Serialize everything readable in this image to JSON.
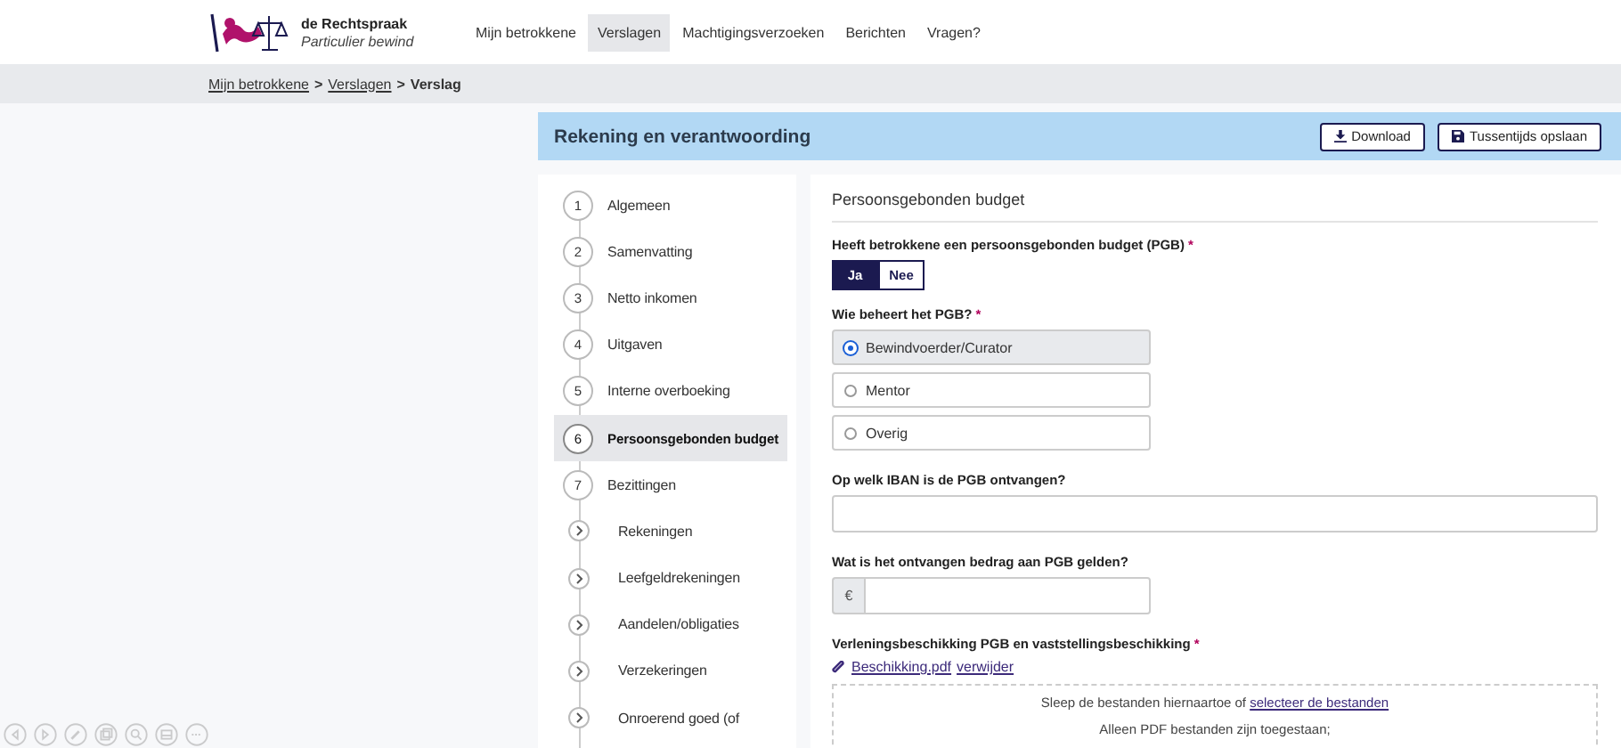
{
  "header": {
    "brand": {
      "title": "de Rechtspraak",
      "subtitle": "Particulier bewind"
    },
    "nav": [
      {
        "label": "Mijn betrokkene",
        "selected": false
      },
      {
        "label": "Verslagen",
        "selected": true
      },
      {
        "label": "Machtigingsverzoeken",
        "selected": false
      },
      {
        "label": "Berichten",
        "selected": false
      },
      {
        "label": "Vragen?",
        "selected": false
      }
    ]
  },
  "breadcrumb": {
    "separator": ">",
    "items": [
      {
        "label": "Mijn betrokkene",
        "kind": "link"
      },
      {
        "label": "Verslagen",
        "kind": "link"
      },
      {
        "label": "Verslag",
        "kind": "current"
      }
    ]
  },
  "title_bar": {
    "title": "Rekening en verantwoording",
    "buttons": [
      {
        "label": "Download",
        "kind": "download"
      },
      {
        "label": "Tussentijds opslaan",
        "kind": "save"
      }
    ]
  },
  "steps": [
    {
      "kind": "step",
      "number": "1",
      "label": "Algemeen",
      "selected": false
    },
    {
      "kind": "step",
      "number": "2",
      "label": "Samenvatting",
      "selected": false
    },
    {
      "kind": "step",
      "number": "3",
      "label": "Netto inkomen",
      "selected": false
    },
    {
      "kind": "step",
      "number": "4",
      "label": "Uitgaven",
      "selected": false
    },
    {
      "kind": "step",
      "number": "5",
      "label": "Interne overboeking",
      "selected": false
    },
    {
      "kind": "step",
      "number": "6",
      "label": "Persoonsgebonden budget",
      "selected": true
    },
    {
      "kind": "step",
      "number": "7",
      "label": "Bezittingen",
      "selected": false
    },
    {
      "kind": "sub",
      "label": "Rekeningen",
      "selected": false
    },
    {
      "kind": "sub",
      "label": "Leefgeldrekeningen",
      "selected": false
    },
    {
      "kind": "sub",
      "label": "Aandelen/obligaties",
      "selected": false
    },
    {
      "kind": "sub",
      "label": "Verzekeringen",
      "selected": false
    },
    {
      "kind": "sub",
      "label": "Onroerend goed (of",
      "selected": false
    }
  ],
  "form": {
    "heading": "Persoonsgebonden budget",
    "q_pgb": {
      "label": "Heeft betrokkene een persoonsgebonden budget (PGB)",
      "required_mark": "*",
      "options": [
        {
          "label": "Ja",
          "selected": true
        },
        {
          "label": "Nee",
          "selected": false
        }
      ]
    },
    "q_beheer": {
      "label": "Wie beheert het PGB?",
      "required_mark": "*",
      "options": [
        {
          "label": "Bewindvoerder/Curator",
          "selected": true
        },
        {
          "label": "Mentor",
          "selected": false
        },
        {
          "label": "Overig",
          "selected": false
        }
      ]
    },
    "q_iban": {
      "label": "Op welk IBAN is de PGB ontvangen?"
    },
    "q_bedrag": {
      "label": "Wat is het ontvangen bedrag aan PGB gelden?",
      "prefix": "€"
    },
    "q_beschikking": {
      "label": "Verleningsbeschikking PGB en vaststellingsbeschikking",
      "required_mark": "*",
      "file": "Beschikking.pdf",
      "remove": "verwijder",
      "dropzone": {
        "text": "Sleep de bestanden hiernaartoe of",
        "link": "selecteer de bestanden",
        "note": "Alleen PDF bestanden zijn toegestaan;"
      }
    }
  },
  "viewer_toolbar": [
    {
      "kind": "prev"
    },
    {
      "kind": "next"
    },
    {
      "kind": "pen"
    },
    {
      "kind": "pages"
    },
    {
      "kind": "search"
    },
    {
      "kind": "screen"
    },
    {
      "kind": "more"
    }
  ]
}
